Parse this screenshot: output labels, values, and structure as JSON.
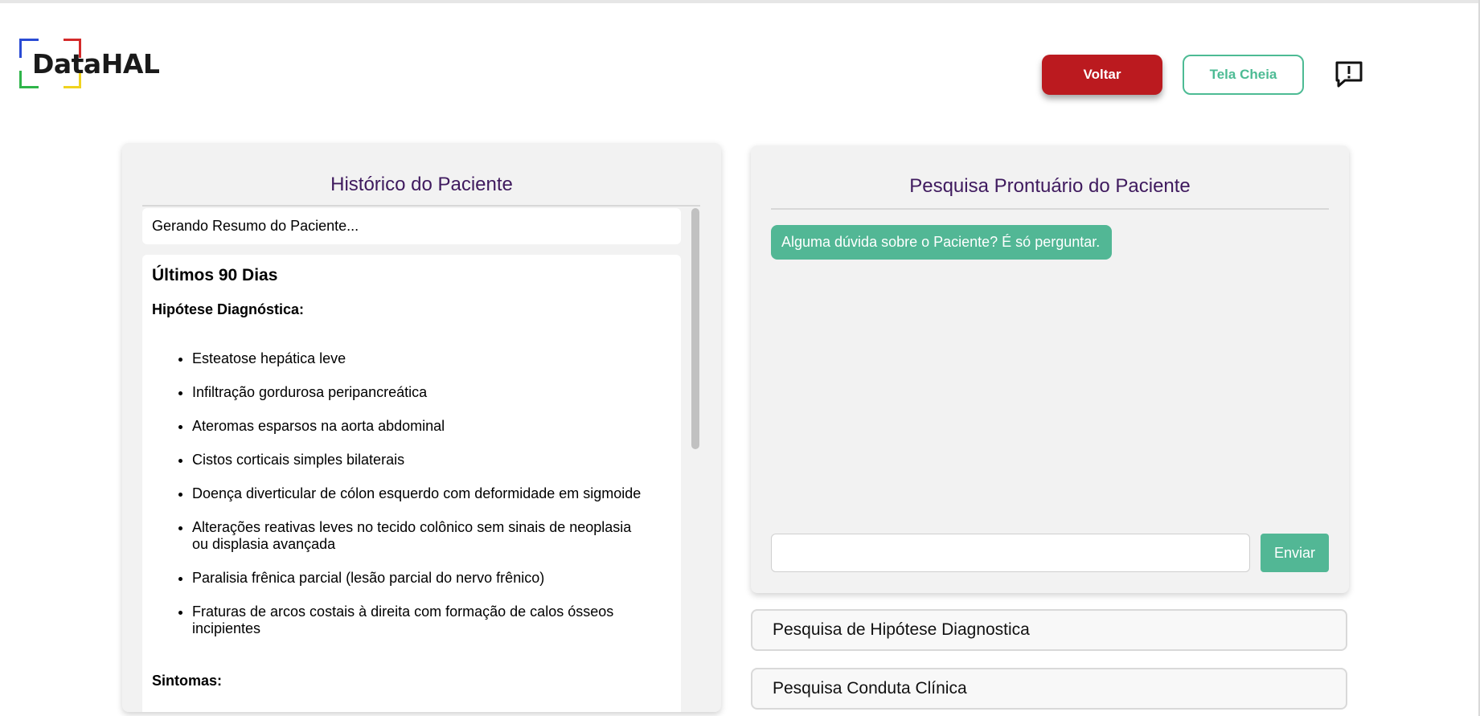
{
  "header": {
    "logo_text": "DataHAL",
    "voltar_label": "Voltar",
    "tela_cheia_label": "Tela Cheia",
    "feedback_icon": "message-alert-icon"
  },
  "historico": {
    "title": "Histórico do Paciente",
    "status": "Gerando Resumo do Paciente...",
    "section_title": "Últimos 90 Dias",
    "hipotese_heading": "Hipótese Diagnóstica:",
    "hipoteses": [
      "Esteatose hepática leve",
      "Infiltração gordurosa peripancreática",
      "Ateromas esparsos na aorta abdominal",
      "Cistos corticais simples bilaterais",
      "Doença diverticular de cólon esquerdo com deformidade em sigmoide",
      "Alterações reativas leves no tecido colônico sem sinais de neoplasia ou displasia avançada",
      "Paralisia frênica parcial (lesão parcial do nervo frênico)",
      "Fraturas de arcos costais à direita com formação de calos ósseos incipientes"
    ],
    "sintomas_heading": "Sintomas:"
  },
  "prontuario": {
    "title": "Pesquisa Prontuário do Paciente",
    "greeting": "Alguma dúvida sobre o Paciente? É só perguntar.",
    "input_value": "",
    "send_label": "Enviar"
  },
  "accordions": [
    {
      "label": "Pesquisa de Hipótese Diagnostica"
    },
    {
      "label": "Pesquisa Conduta Clínica"
    }
  ],
  "colors": {
    "voltar_bg": "#bb1a1f",
    "accent_green": "#52b795",
    "title_purple": "#3f1a5e"
  }
}
